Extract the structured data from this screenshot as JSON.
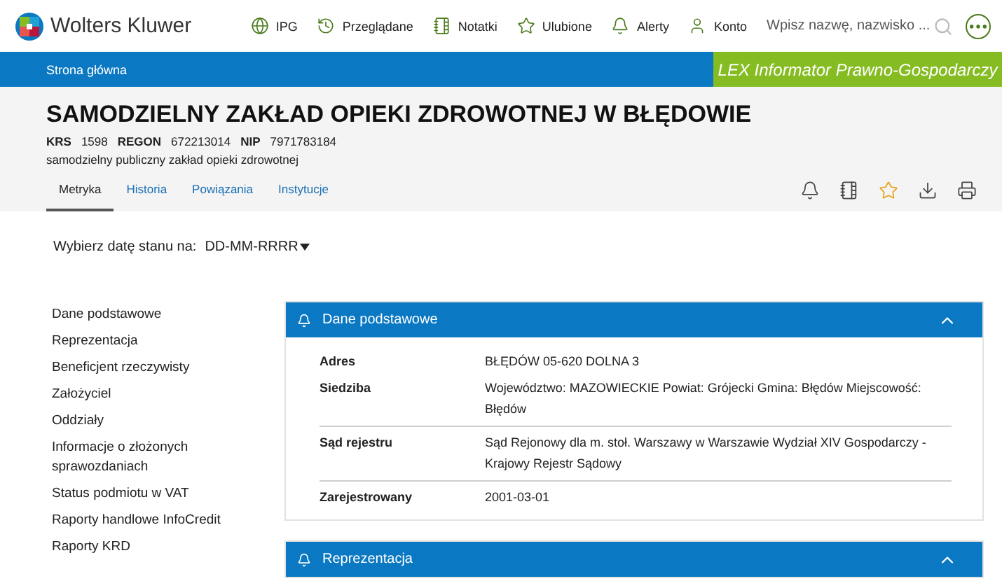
{
  "header": {
    "logo": "Wolters Kluwer",
    "nav": [
      "IPG",
      "Przeglądane",
      "Notatki",
      "Ulubione",
      "Alerty",
      "Konto"
    ],
    "search": {
      "placeholder": "Wpisz nazwę, nazwisko ..."
    }
  },
  "breadcrumb": {
    "label": "Strona główna",
    "product": "LEX Informator Prawno-Gospodarczy"
  },
  "entity": {
    "name": "SAMODZIELNY ZAKŁAD OPIEKI ZDROWOTNEJ W BŁĘDOWIE",
    "ids": [
      {
        "label": "KRS",
        "value": "1598"
      },
      {
        "label": "REGON",
        "value": "672213014"
      },
      {
        "label": "NIP",
        "value": "7971783184"
      }
    ],
    "type": "samodzielny publiczny zakład opieki zdrowotnej"
  },
  "tabs": [
    {
      "label": "Metryka",
      "selected": true
    },
    {
      "label": "Historia",
      "selected": false
    },
    {
      "label": "Powiązania",
      "selected": false
    },
    {
      "label": "Instytucje",
      "selected": false
    }
  ],
  "actions": [
    {
      "on": false
    },
    {
      "on": false
    },
    {
      "on": true
    },
    {
      "on": false
    },
    {
      "on": false
    }
  ],
  "date_picker": {
    "label": "Wybierz datę stanu na:",
    "value": "DD-MM-RRRR"
  },
  "sidebar": {
    "items": [
      "Dane podstawowe",
      "Reprezentacja",
      "Beneficjent rzeczywisty",
      "Założyciel",
      "Oddziały",
      "Informacje o złożonych sprawozdaniach",
      "Status podmiotu w VAT",
      "Raporty handlowe InfoCredit",
      "Raporty KRD"
    ]
  },
  "sections": [
    {
      "title": "Dane podstawowe",
      "expanded": true,
      "groups": [
        [
          {
            "label": "Adres",
            "value": "BŁĘDÓW 05-620 DOLNA 3"
          },
          {
            "label": "Siedziba",
            "value": "Województwo: MAZOWIECKIE Powiat: Grójecki Gmina: Błędów Miejscowość: Błędów"
          }
        ],
        [
          {
            "label": "Sąd rejestru",
            "value": "Sąd Rejonowy dla m. stoł. Warszawy w Warszawie Wydział XIV Gospodarczy - Krajowy Rejestr Sądowy"
          }
        ],
        [
          {
            "label": "Zarejestrowany",
            "value": "2001-03-01"
          }
        ]
      ]
    },
    {
      "title": "Reprezentacja",
      "expanded": true
    }
  ]
}
